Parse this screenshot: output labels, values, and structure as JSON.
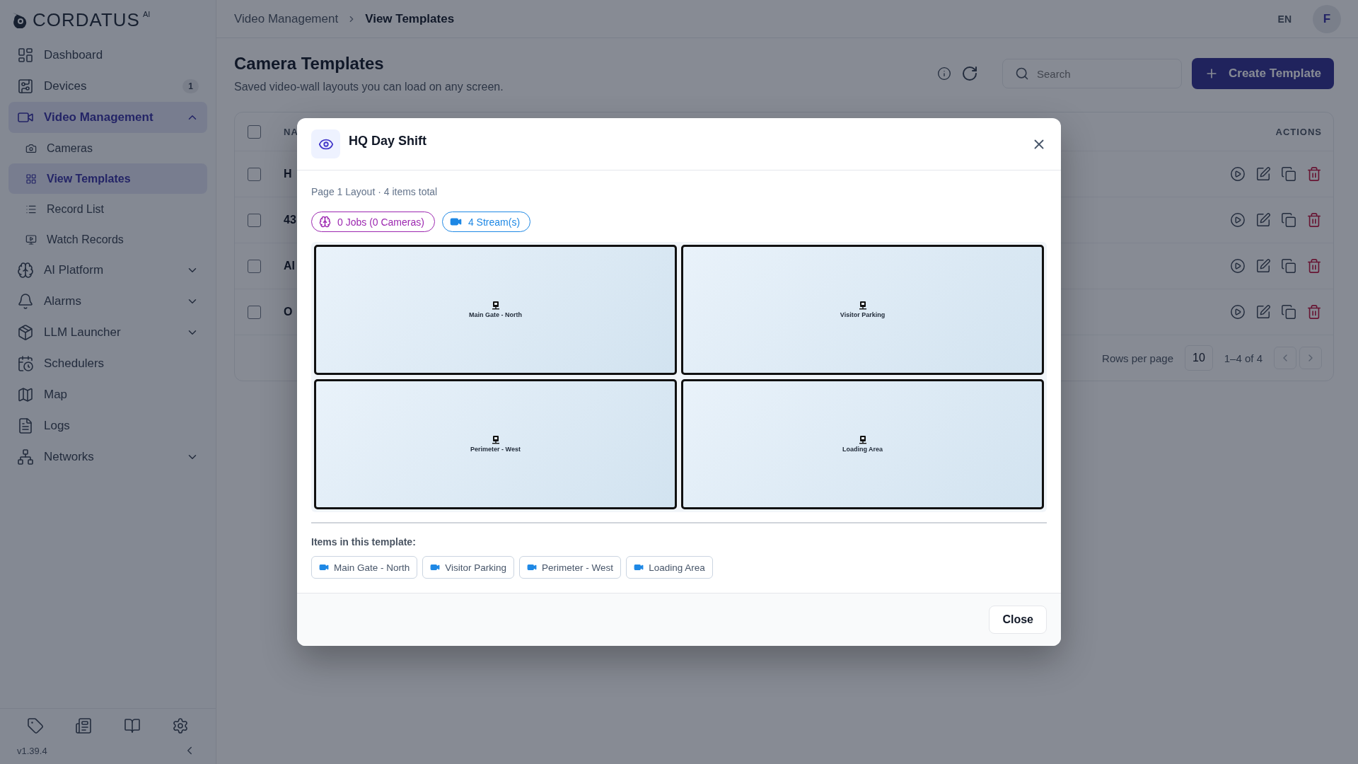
{
  "sidebar": {
    "logo": {
      "name": "CORDATUS",
      "suffix": "AI"
    },
    "items": [
      {
        "label": "Dashboard",
        "selected": false
      },
      {
        "label": "Devices",
        "badge": "1",
        "selected": false
      },
      {
        "label": "Video Management",
        "selected": true,
        "expanded": true,
        "children": [
          {
            "label": "Cameras",
            "selected": false
          },
          {
            "label": "View Templates",
            "selected": true
          },
          {
            "label": "Record List",
            "selected": false
          },
          {
            "label": "Watch Records",
            "selected": false
          }
        ]
      },
      {
        "label": "AI Platform",
        "selected": false,
        "expanded": false
      },
      {
        "label": "Alarms",
        "selected": false,
        "expanded": false
      },
      {
        "label": "LLM Launcher",
        "selected": false,
        "expanded": false
      },
      {
        "label": "Schedulers",
        "selected": false
      },
      {
        "label": "Map",
        "selected": false
      },
      {
        "label": "Logs",
        "selected": false
      },
      {
        "label": "Networks",
        "selected": false,
        "expanded": false
      }
    ],
    "version": "v1.39.4"
  },
  "topbar": {
    "breadcrumb": [
      "Video Management",
      "View Templates"
    ],
    "language": "EN",
    "avatar": "F"
  },
  "page": {
    "title": "Camera Templates",
    "subtitle": "Saved video-wall layouts you can load on any screen.",
    "search": {
      "placeholder": "Search"
    },
    "create_button": "Create Template"
  },
  "table": {
    "select_all_checked": false,
    "columns": [
      "NA",
      "ACTIONS"
    ],
    "rows": [
      {
        "name": "H",
        "checked": false
      },
      {
        "name": "43",
        "checked": false
      },
      {
        "name": "AI",
        "checked": false
      },
      {
        "name": "O",
        "checked": false
      }
    ],
    "pagination": {
      "rows_per_page_label": "Rows per page",
      "rows_per_page": "10",
      "range": "1–4 of 4"
    }
  },
  "modal": {
    "title": "HQ Day Shift",
    "summary": "Page 1 Layout · 4 items total",
    "chips": [
      {
        "kind": "jobs",
        "label": "0 Jobs (0 Cameras)",
        "color": "#9c27b0"
      },
      {
        "kind": "streams",
        "label": "4 Stream(s)",
        "color": "#1e88e5"
      }
    ],
    "tiles": [
      {
        "label": "Main Gate - North"
      },
      {
        "label": "Visitor Parking"
      },
      {
        "label": "Perimeter - West"
      },
      {
        "label": "Loading Area"
      }
    ],
    "items_heading": "Items in this template:",
    "items": [
      "Main Gate - North",
      "Visitor Parking",
      "Perimeter - West",
      "Loading Area"
    ],
    "close_button": "Close"
  }
}
